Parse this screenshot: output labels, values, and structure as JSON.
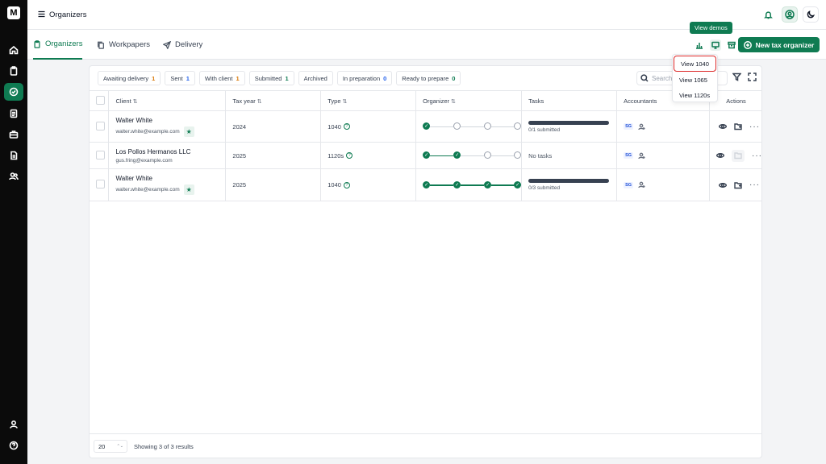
{
  "app": {
    "title": "Organizers"
  },
  "rail": {
    "icons": [
      "home-icon",
      "clipboard-icon",
      "organizer-icon",
      "document-icon",
      "briefcase-icon",
      "file-text-icon",
      "users-icon"
    ],
    "bottom_icons": [
      "user-icon",
      "help-icon"
    ]
  },
  "tabs": [
    {
      "label": "Organizers",
      "active": true
    },
    {
      "label": "Workpapers",
      "active": false
    },
    {
      "label": "Delivery",
      "active": false
    }
  ],
  "actions": {
    "new_button": "New tax organizer",
    "tooltip": "View demos"
  },
  "demo_menu": {
    "items": [
      "View 1040",
      "View 1065",
      "View 1120s"
    ]
  },
  "filters": [
    {
      "label": "Awaiting delivery",
      "count": "1",
      "color": "#d97706"
    },
    {
      "label": "Sent",
      "count": "1",
      "color": "#2563eb"
    },
    {
      "label": "With client",
      "count": "1",
      "color": "#d97706"
    },
    {
      "label": "Submitted",
      "count": "1",
      "color": "#0f7b52"
    },
    {
      "label": "Archived",
      "count": "",
      "color": "#374151"
    },
    {
      "label": "In preparation",
      "count": "0",
      "color": "#2563eb"
    },
    {
      "label": "Ready to prepare",
      "count": "0",
      "color": "#0f7b52"
    }
  ],
  "search": {
    "placeholder": "Search"
  },
  "table": {
    "columns": {
      "client": "Client",
      "tax_year": "Tax year",
      "type": "Type",
      "organizer": "Organizer",
      "tasks": "Tasks",
      "accountants": "Accountants",
      "actions": "Actions"
    },
    "rows": [
      {
        "client": "Walter White",
        "email": "walter.white@example.com",
        "starred": true,
        "tax_year": "2024",
        "type": "1040",
        "organizer_progress": 1,
        "tasks": "0/1 submitted",
        "has_task_bar": true,
        "accountant": "SG",
        "doc_action_enabled": true
      },
      {
        "client": "Los Pollos Hermanos LLC",
        "email": "gus.fring@example.com",
        "starred": false,
        "tax_year": "2025",
        "type": "1120s",
        "organizer_progress": 2,
        "tasks": "No tasks",
        "has_task_bar": false,
        "accountant": "SG",
        "doc_action_enabled": false
      },
      {
        "client": "Walter White",
        "email": "walter.white@example.com",
        "starred": true,
        "tax_year": "2025",
        "type": "1040",
        "organizer_progress": 4,
        "tasks": "0/3 submitted",
        "has_task_bar": true,
        "accountant": "SG",
        "doc_action_enabled": true
      }
    ]
  },
  "footer": {
    "page_size": "20",
    "showing": "Showing 3 of 3 results"
  },
  "colors": {
    "accent": "#0f7b52",
    "rail": "#0b0b0b",
    "highlight": "#dc2626"
  }
}
